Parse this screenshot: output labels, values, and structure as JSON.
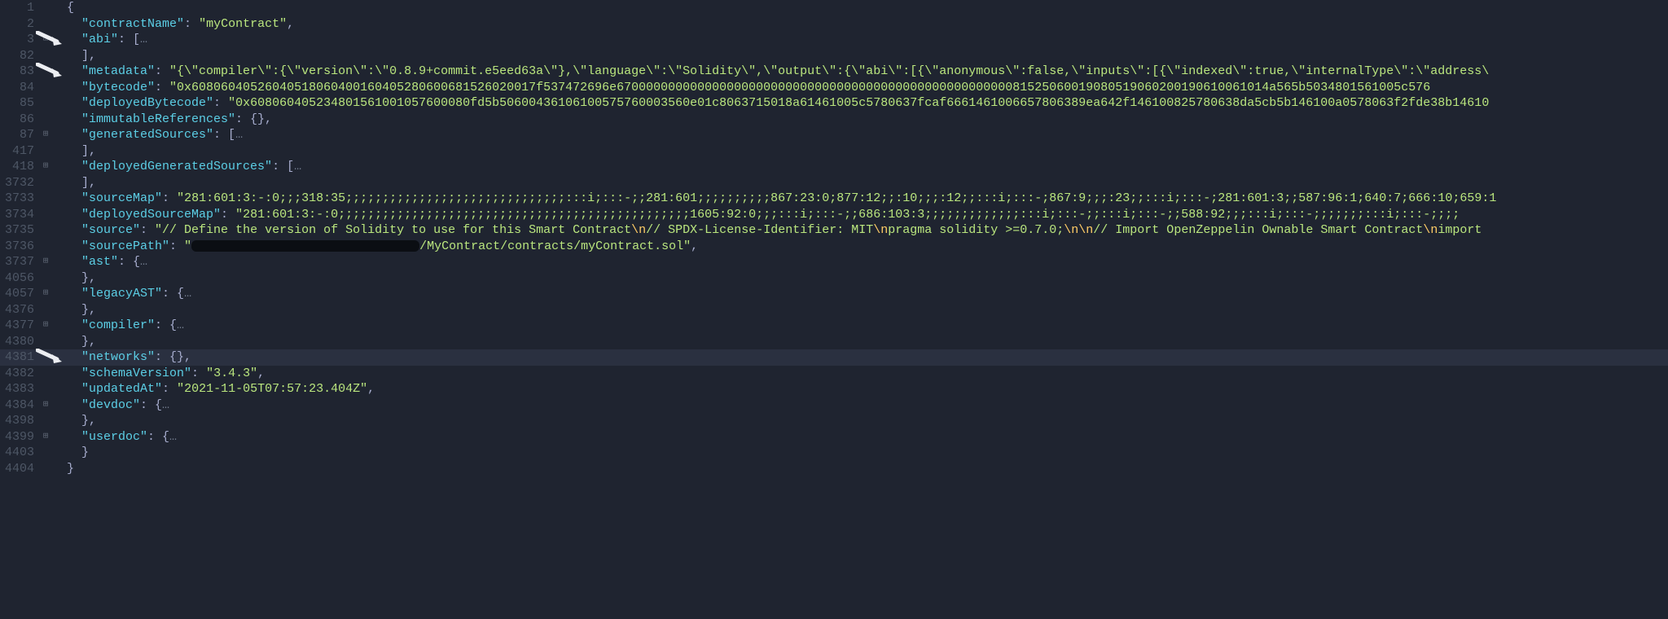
{
  "lines": [
    {
      "num": "1",
      "fold": "",
      "indent": 1,
      "parts": [
        {
          "t": "punc",
          "v": "{"
        }
      ]
    },
    {
      "num": "2",
      "fold": "",
      "indent": 2,
      "parts": [
        {
          "t": "key",
          "v": "\"contractName\""
        },
        {
          "t": "punc",
          "v": ": "
        },
        {
          "t": "str",
          "v": "\"myContract\""
        },
        {
          "t": "punc",
          "v": ","
        }
      ]
    },
    {
      "num": "3",
      "fold": "⊞",
      "indent": 2,
      "parts": [
        {
          "t": "key",
          "v": "\"abi\""
        },
        {
          "t": "punc",
          "v": ": ["
        },
        {
          "t": "ellip",
          "v": "…"
        }
      ]
    },
    {
      "num": "82",
      "fold": "",
      "indent": 2,
      "parts": [
        {
          "t": "punc",
          "v": "],"
        }
      ]
    },
    {
      "num": "83",
      "fold": "",
      "indent": 2,
      "parts": [
        {
          "t": "key",
          "v": "\"metadata\""
        },
        {
          "t": "punc",
          "v": ": "
        },
        {
          "t": "str",
          "v": "\"{\\\"compiler\\\":{\\\"version\\\":\\\"0.8.9+commit.e5eed63a\\\"},\\\"language\\\":\\\"Solidity\\\",\\\"output\\\":{\\\"abi\\\":[{\\\"anonymous\\\":false,\\\"inputs\\\":[{\\\"indexed\\\":true,\\\"internalType\\\":\\\"address\\"
        }
      ]
    },
    {
      "num": "84",
      "fold": "",
      "indent": 2,
      "parts": [
        {
          "t": "key",
          "v": "\"bytecode\""
        },
        {
          "t": "punc",
          "v": ": "
        },
        {
          "t": "str",
          "v": "\"0x60806040526040518060400160405280600681526020017f537472696e67000000000000000000000000000000000000000000000000000081525060019080519060200190610061014a565b5034801561005c576"
        }
      ]
    },
    {
      "num": "85",
      "fold": "",
      "indent": 2,
      "parts": [
        {
          "t": "key",
          "v": "\"deployedBytecode\""
        },
        {
          "t": "punc",
          "v": ": "
        },
        {
          "t": "str",
          "v": "\"0x608060405234801561001057600080fd5b50600436106100575760003560e01c8063715018a61461005c5780637fcaf6661461006657806389ea642f146100825780638da5cb5b146100a0578063f2fde38b14610"
        }
      ]
    },
    {
      "num": "86",
      "fold": "",
      "indent": 2,
      "parts": [
        {
          "t": "key",
          "v": "\"immutableReferences\""
        },
        {
          "t": "punc",
          "v": ": {},"
        }
      ]
    },
    {
      "num": "87",
      "fold": "⊞",
      "indent": 2,
      "parts": [
        {
          "t": "key",
          "v": "\"generatedSources\""
        },
        {
          "t": "punc",
          "v": ": ["
        },
        {
          "t": "ellip",
          "v": "…"
        }
      ]
    },
    {
      "num": "417",
      "fold": "",
      "indent": 2,
      "parts": [
        {
          "t": "punc",
          "v": "],"
        }
      ]
    },
    {
      "num": "418",
      "fold": "⊞",
      "indent": 2,
      "parts": [
        {
          "t": "key",
          "v": "\"deployedGeneratedSources\""
        },
        {
          "t": "punc",
          "v": ": ["
        },
        {
          "t": "ellip",
          "v": "…"
        }
      ]
    },
    {
      "num": "3732",
      "fold": "",
      "indent": 2,
      "parts": [
        {
          "t": "punc",
          "v": "],"
        }
      ]
    },
    {
      "num": "3733",
      "fold": "",
      "indent": 2,
      "parts": [
        {
          "t": "key",
          "v": "\"sourceMap\""
        },
        {
          "t": "punc",
          "v": ": "
        },
        {
          "t": "str",
          "v": "\"281:601:3:-:0;;;318:35;;;;;;;;;;;;;;;;;;;;;;;;;;;;;;:::i;:::-;;281:601;;;;;;;;;;867:23:0;877:12;;:10;;;:12;;:::i;:::-;867:9;;;:23;;:::i;:::-;281:601:3;;587:96:1;640:7;666:10;659:1"
        }
      ]
    },
    {
      "num": "3734",
      "fold": "",
      "indent": 2,
      "parts": [
        {
          "t": "key",
          "v": "\"deployedSourceMap\""
        },
        {
          "t": "punc",
          "v": ": "
        },
        {
          "t": "str",
          "v": "\"281:601:3:-:0;;;;;;;;;;;;;;;;;;;;;;;;;;;;;;;;;;;;;;;;;;;;;;;;1605:92:0;;;:::i;:::-;;686:103:3;;;;;;;;;;;;;:::i;:::-;;:::i;:::-;;588:92;;;:::i;:::-;;;;;;;:::i;:::-;;;;"
        }
      ]
    },
    {
      "num": "3735",
      "fold": "",
      "indent": 2,
      "parts": [
        {
          "t": "key",
          "v": "\"source\""
        },
        {
          "t": "punc",
          "v": ": "
        },
        {
          "t": "str",
          "v": "\"// Define the version of Solidity to use for this Smart Contract"
        },
        {
          "t": "esc",
          "v": "\\n"
        },
        {
          "t": "str",
          "v": "// SPDX-License-Identifier: MIT"
        },
        {
          "t": "esc",
          "v": "\\n"
        },
        {
          "t": "str",
          "v": "pragma solidity >=0.7.0;"
        },
        {
          "t": "esc",
          "v": "\\n\\n"
        },
        {
          "t": "str",
          "v": "// Import OpenZeppelin Ownable Smart Contract"
        },
        {
          "t": "esc",
          "v": "\\n"
        },
        {
          "t": "str",
          "v": "import"
        }
      ]
    },
    {
      "num": "3736",
      "fold": "",
      "indent": 2,
      "parts": [
        {
          "t": "key",
          "v": "\"sourcePath\""
        },
        {
          "t": "punc",
          "v": ": "
        },
        {
          "t": "str",
          "v": "\""
        },
        {
          "t": "redact",
          "v": ""
        },
        {
          "t": "str",
          "v": "/MyContract/contracts/myContract.sol\""
        },
        {
          "t": "punc",
          "v": ","
        }
      ]
    },
    {
      "num": "3737",
      "fold": "⊞",
      "indent": 2,
      "parts": [
        {
          "t": "key",
          "v": "\"ast\""
        },
        {
          "t": "punc",
          "v": ": {"
        },
        {
          "t": "ellip",
          "v": "…"
        }
      ]
    },
    {
      "num": "4056",
      "fold": "",
      "indent": 2,
      "parts": [
        {
          "t": "punc",
          "v": "},"
        }
      ]
    },
    {
      "num": "4057",
      "fold": "⊞",
      "indent": 2,
      "parts": [
        {
          "t": "key",
          "v": "\"legacyAST\""
        },
        {
          "t": "punc",
          "v": ": {"
        },
        {
          "t": "ellip",
          "v": "…"
        }
      ]
    },
    {
      "num": "4376",
      "fold": "",
      "indent": 2,
      "parts": [
        {
          "t": "punc",
          "v": "},"
        }
      ]
    },
    {
      "num": "4377",
      "fold": "⊞",
      "indent": 2,
      "parts": [
        {
          "t": "key",
          "v": "\"compiler\""
        },
        {
          "t": "punc",
          "v": ": {"
        },
        {
          "t": "ellip",
          "v": "…"
        }
      ]
    },
    {
      "num": "4380",
      "fold": "",
      "indent": 2,
      "parts": [
        {
          "t": "punc",
          "v": "},"
        }
      ]
    },
    {
      "num": "4381",
      "fold": "",
      "indent": 2,
      "hl": true,
      "parts": [
        {
          "t": "key",
          "v": "\"networks\""
        },
        {
          "t": "punc",
          "v": ": {},"
        }
      ]
    },
    {
      "num": "4382",
      "fold": "",
      "indent": 2,
      "parts": [
        {
          "t": "key",
          "v": "\"schemaVersion\""
        },
        {
          "t": "punc",
          "v": ": "
        },
        {
          "t": "str",
          "v": "\"3.4.3\""
        },
        {
          "t": "punc",
          "v": ","
        }
      ]
    },
    {
      "num": "4383",
      "fold": "",
      "indent": 2,
      "parts": [
        {
          "t": "key",
          "v": "\"updatedAt\""
        },
        {
          "t": "punc",
          "v": ": "
        },
        {
          "t": "str",
          "v": "\"2021-11-05T07:57:23.404Z\""
        },
        {
          "t": "punc",
          "v": ","
        }
      ]
    },
    {
      "num": "4384",
      "fold": "⊞",
      "indent": 2,
      "parts": [
        {
          "t": "key",
          "v": "\"devdoc\""
        },
        {
          "t": "punc",
          "v": ": {"
        },
        {
          "t": "ellip",
          "v": "…"
        }
      ]
    },
    {
      "num": "4398",
      "fold": "",
      "indent": 2,
      "parts": [
        {
          "t": "punc",
          "v": "},"
        }
      ]
    },
    {
      "num": "4399",
      "fold": "⊞",
      "indent": 2,
      "parts": [
        {
          "t": "key",
          "v": "\"userdoc\""
        },
        {
          "t": "punc",
          "v": ": {"
        },
        {
          "t": "ellip",
          "v": "…"
        }
      ]
    },
    {
      "num": "4403",
      "fold": "",
      "indent": 2,
      "parts": [
        {
          "t": "punc",
          "v": "}"
        }
      ]
    },
    {
      "num": "4404",
      "fold": "",
      "indent": 1,
      "parts": [
        {
          "t": "punc",
          "v": "}"
        }
      ]
    }
  ],
  "arrows": [
    {
      "index": 2
    },
    {
      "index": 4
    },
    {
      "index": 22
    }
  ]
}
